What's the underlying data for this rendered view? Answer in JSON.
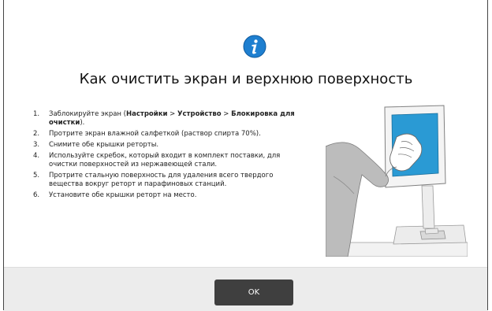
{
  "dialog": {
    "title": "Как очистить экран и верхнюю поверхность",
    "icon": "info-icon",
    "steps": [
      {
        "num": "1.",
        "parts": [
          {
            "text": "Заблокируйте экран (",
            "bold": false
          },
          {
            "text": "Настройки",
            "bold": true
          },
          {
            "text": " > ",
            "bold": false
          },
          {
            "text": "Устройство",
            "bold": true
          },
          {
            "text": " > ",
            "bold": false
          },
          {
            "text": "Блокировка для очистки",
            "bold": true
          },
          {
            "text": ").",
            "bold": false
          }
        ]
      },
      {
        "num": "2.",
        "parts": [
          {
            "text": "Протрите экран влажной салфеткой (раствор спирта 70%).",
            "bold": false
          }
        ]
      },
      {
        "num": "3.",
        "parts": [
          {
            "text": "Снимите обе крышки реторты.",
            "bold": false
          }
        ]
      },
      {
        "num": "4.",
        "parts": [
          {
            "text": "Используйте скребок, который входит в комплект поставки, для очистки поверхностей из нержавеющей стали.",
            "bold": false
          }
        ]
      },
      {
        "num": "5.",
        "parts": [
          {
            "text": "Протрите стальную поверхность для удаления всего твердого вещества вокруг реторт и парафиновых станций.",
            "bold": false
          }
        ]
      },
      {
        "num": "6.",
        "parts": [
          {
            "text": "Установите обе крышки реторт на место.",
            "bold": false
          }
        ]
      }
    ],
    "ok_label": "OK"
  },
  "colors": {
    "icon_blue": "#1e7fd0",
    "screen_blue": "#2a9ad4",
    "button_bg": "#3f3f3f",
    "footer_bg": "#ececec"
  }
}
